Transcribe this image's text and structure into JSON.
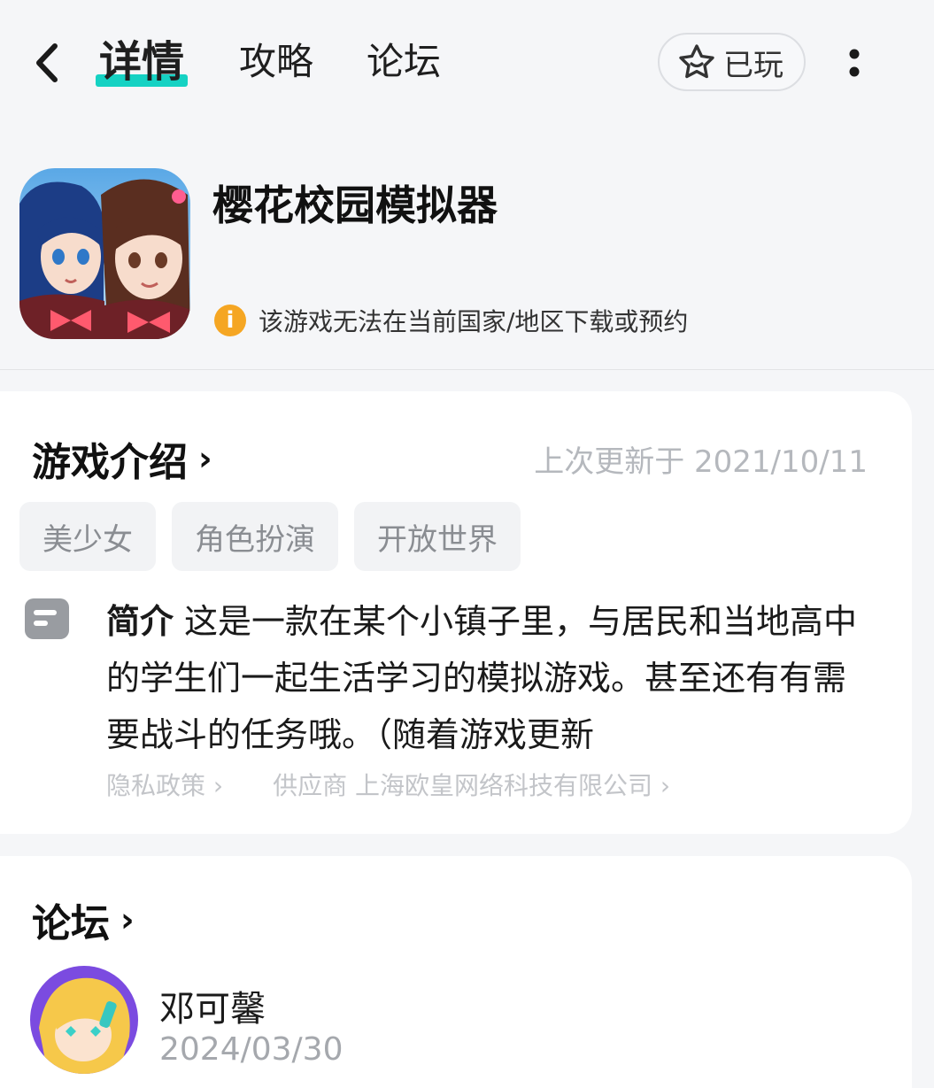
{
  "nav": {
    "tabs": [
      {
        "label": "详情",
        "active": true
      },
      {
        "label": "攻略",
        "active": false
      },
      {
        "label": "论坛",
        "active": false
      }
    ],
    "played_label": "已玩",
    "accent": "#15d2c3"
  },
  "game": {
    "title": "樱花校园模拟器",
    "region_notice": "该游戏无法在当前国家/地区下载或预约",
    "notice_color": "#f5a623"
  },
  "intro": {
    "heading": "游戏介绍",
    "updated": "上次更新于 2021/10/11",
    "tags": [
      "美少女",
      "角色扮演",
      "开放世界"
    ],
    "summary_label": "简介",
    "summary_text": "这是一款在某个小镇子里，与居民和当地高中的学生们一起生活学习的模拟游戏。甚至还有有需要战斗的任务哦。（随着游戏更新",
    "privacy_link": "隐私政策",
    "supplier_link": "供应商 上海欧皇网络科技有限公司"
  },
  "forum": {
    "heading": "论坛",
    "post": {
      "author": "邓可馨",
      "date": "2024/03/30"
    }
  }
}
